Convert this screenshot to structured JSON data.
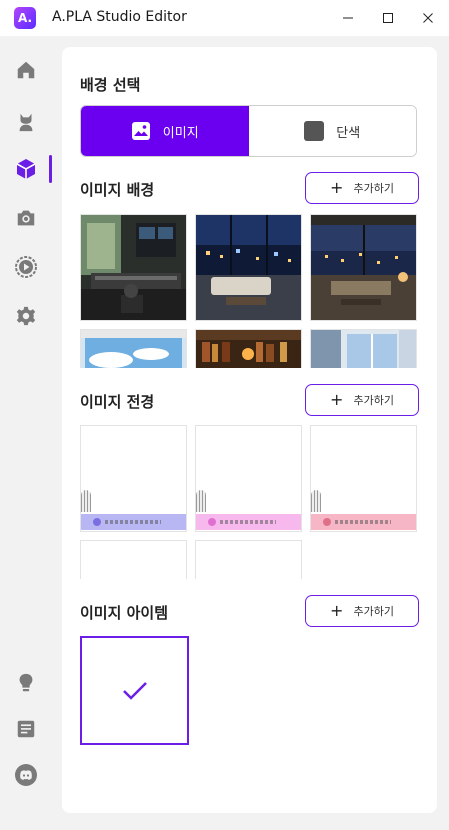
{
  "window": {
    "logo_text": "A.",
    "title": "A.PLA Studio Editor"
  },
  "sidebar": {
    "items": [
      {
        "icon": "home-icon"
      },
      {
        "icon": "avatar-icon"
      },
      {
        "icon": "cube-icon",
        "active": true
      },
      {
        "icon": "camera-icon"
      },
      {
        "icon": "play-icon"
      },
      {
        "icon": "gear-icon"
      },
      {
        "icon": "lightbulb-icon"
      },
      {
        "icon": "document-icon"
      },
      {
        "icon": "discord-icon"
      }
    ]
  },
  "background": {
    "title": "배경 선택",
    "options": [
      {
        "label": "이미지",
        "selected": true
      },
      {
        "label": "단색",
        "selected": false
      }
    ]
  },
  "image_background": {
    "title": "이미지 배경",
    "add_label": "추가하기",
    "thumbnails": [
      "music-studio",
      "city-night-livingroom",
      "lounge-night-view",
      "sky-window",
      "library",
      "balcony-day"
    ]
  },
  "image_foreground": {
    "title": "이미지 전경",
    "add_label": "추가하기",
    "thumbnails": [
      {
        "bar_color": "#b9b6f4",
        "dot_color": "#7a6fe0"
      },
      {
        "bar_color": "#f7b8ee",
        "dot_color": "#e070d0"
      },
      {
        "bar_color": "#f6b6c6",
        "dot_color": "#e07088"
      },
      {
        "bar_color": "#ffffff",
        "dot_color": "#ffffff"
      },
      {
        "bar_color": "#ffffff",
        "dot_color": "#ffffff"
      }
    ]
  },
  "image_item": {
    "title": "이미지 아이템",
    "add_label": "추가하기"
  },
  "colors": {
    "accent": "#6b00f0",
    "accent_border": "#6b1ee6"
  }
}
